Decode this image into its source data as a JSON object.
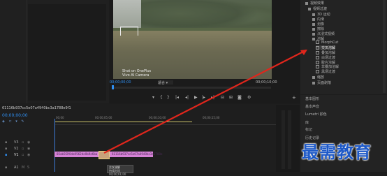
{
  "monitor": {
    "watermark_line1": "Shot on OnePlus",
    "watermark_line2": "Vivo AI Camera",
    "timecode_current": "00;00;00;00",
    "zoom_select": "适合",
    "timecode_end": "00;00;10;00"
  },
  "effects": {
    "items": [
      {
        "label": "视频效果",
        "kind": "folder"
      },
      {
        "label": "视频过渡",
        "kind": "folder"
      },
      {
        "label": "3D 运动",
        "kind": "folder"
      },
      {
        "label": "内滑",
        "kind": "folder"
      },
      {
        "label": "划像",
        "kind": "folder"
      },
      {
        "label": "擦除",
        "kind": "folder"
      },
      {
        "label": "沉浸式视频",
        "kind": "folder"
      },
      {
        "label": "溶解",
        "kind": "folder-open"
      },
      {
        "label": "MorphCut",
        "kind": "item"
      },
      {
        "label": "交叉溶解",
        "kind": "item-selected"
      },
      {
        "label": "叠加溶解",
        "kind": "item"
      },
      {
        "label": "白场过渡",
        "kind": "item"
      },
      {
        "label": "胶片溶解",
        "kind": "item"
      },
      {
        "label": "非叠加溶解",
        "kind": "item"
      },
      {
        "label": "黑场过渡",
        "kind": "item"
      },
      {
        "label": "缩放",
        "kind": "folder"
      },
      {
        "label": "页面剥落",
        "kind": "folder"
      }
    ]
  },
  "right_panel": {
    "rows": [
      "基本图形",
      "基本声音",
      "Lumetri 颜色",
      "库",
      "标记",
      "历史记录",
      "信息"
    ]
  },
  "timeline": {
    "sequence_name": "61116b937cc5e07a4940bc3a1788e9f1",
    "timecode": "00;00;00;00",
    "ruler": [
      "00;00",
      "00;00;05;00",
      "00;00;10;00",
      "00;00;15;00"
    ],
    "tracks": [
      "V3",
      "V2",
      "V1",
      "A1"
    ],
    "clip1_label": "85ab5f2f0da9562de0b9e6ba",
    "clip2_label": "61116b937cc5e07a4940bc3a1788e",
    "tooltip_line1": "交叉溶解",
    "tooltip_line2": "持续时间 00;00;01;00"
  },
  "brand": {
    "text": "最需教育"
  }
}
